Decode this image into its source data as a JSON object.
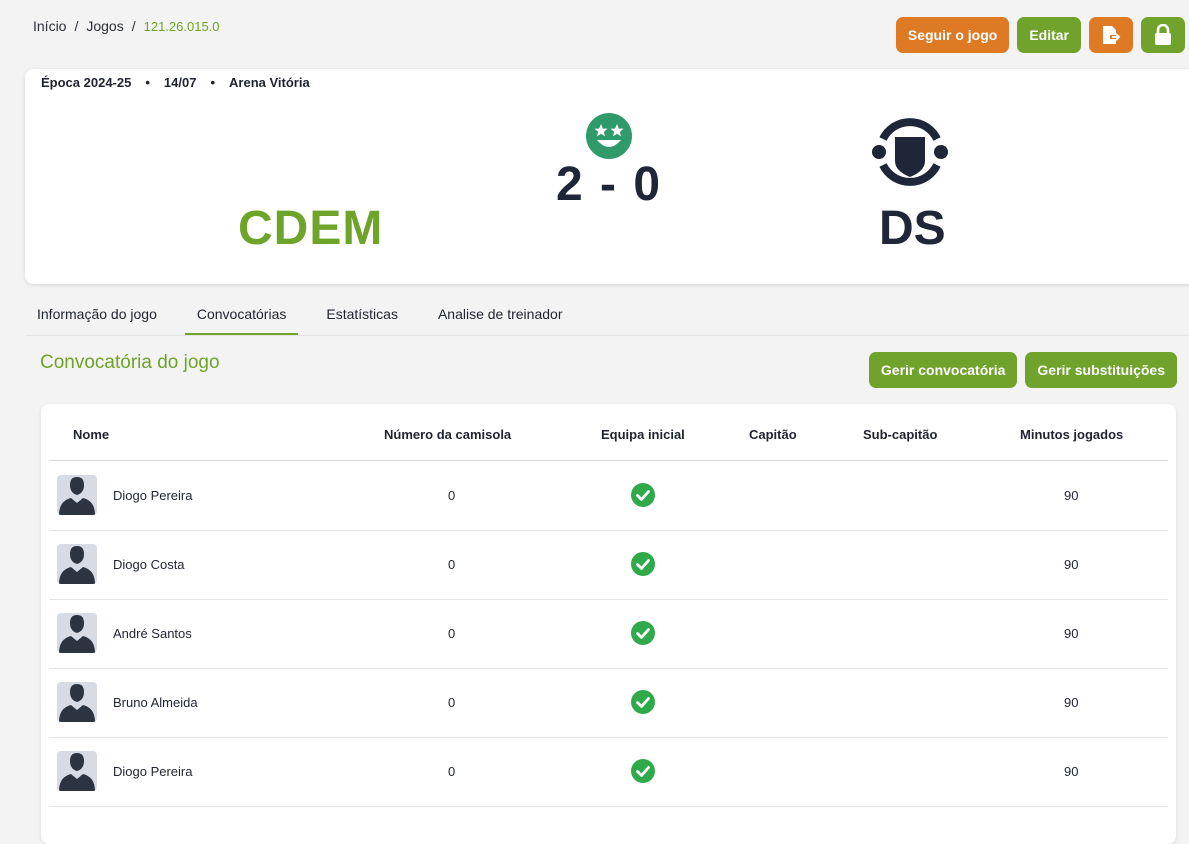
{
  "breadcrumb": {
    "home": "Início",
    "games": "Jogos",
    "current": "121.26.015.0"
  },
  "header_actions": {
    "follow": "Seguir o jogo",
    "edit": "Editar",
    "export_icon": "export-icon",
    "lock_icon": "lock-icon"
  },
  "match": {
    "season": "Época 2024-25",
    "date": "14/07",
    "venue": "Arena Vitória",
    "home_team": "CDEM",
    "away_team": "DS",
    "score": "2 - 0",
    "result_icon": "star-eyes-face-icon"
  },
  "tabs": [
    "Informação do jogo",
    "Convocatórias",
    "Estatísticas",
    "Analise de treinador"
  ],
  "squad": {
    "title": "Convocatória do jogo",
    "manage_callup": "Gerir convocatória",
    "manage_subs": "Gerir substituições",
    "columns": [
      "Nome",
      "Número da camisola",
      "Equipa inicial",
      "Capitão",
      "Sub-capitão",
      "Minutos jogados"
    ],
    "rows": [
      {
        "name": "Diogo Pereira",
        "number": "0",
        "starter": true,
        "minutes": "90"
      },
      {
        "name": "Diogo Costa",
        "number": "0",
        "starter": true,
        "minutes": "90"
      },
      {
        "name": "André Santos",
        "number": "0",
        "starter": true,
        "minutes": "90"
      },
      {
        "name": "Bruno Almeida",
        "number": "0",
        "starter": true,
        "minutes": "90"
      },
      {
        "name": "Diogo Pereira",
        "number": "0",
        "starter": true,
        "minutes": "90"
      }
    ]
  },
  "colors": {
    "accent_green": "#6fa32b",
    "accent_orange": "#dd7a23",
    "check_green": "#2eaa4a",
    "dark": "#1f2638"
  }
}
